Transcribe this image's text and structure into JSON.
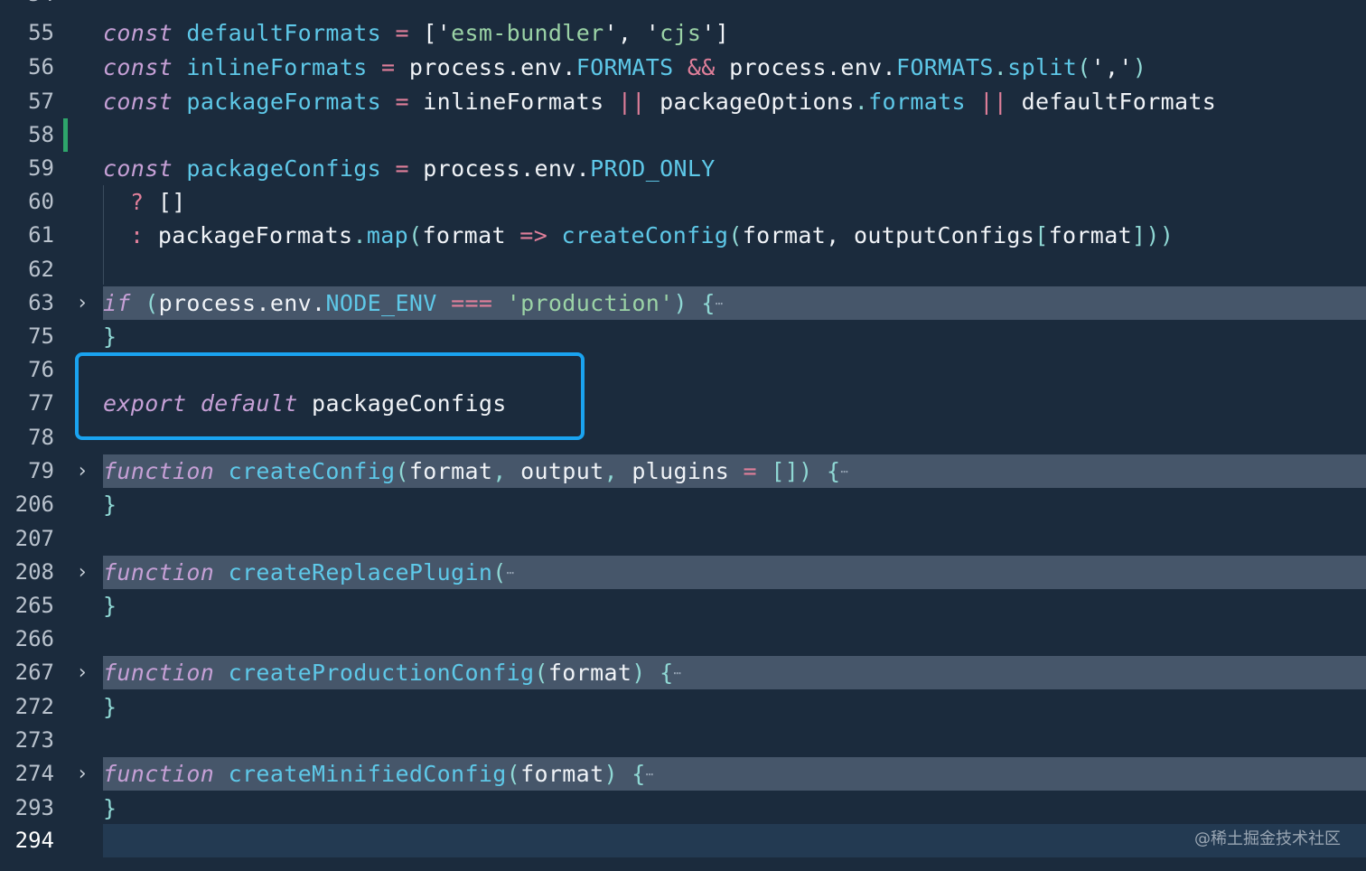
{
  "editor": {
    "top_partial_line_number": "54",
    "watermark": "@稀土掘金技术社区",
    "lines": {
      "l55": {
        "num": "55",
        "t": [
          "const",
          "defaultFormats",
          "=",
          "['",
          "esm-bundler",
          "', '",
          "cjs",
          "']"
        ]
      },
      "l56": {
        "num": "56",
        "t": [
          "const",
          "inlineFormats",
          "=",
          "process",
          ".env.",
          "FORMATS",
          "&&",
          "process",
          ".env.",
          "FORMATS",
          ".",
          "split",
          "(",
          "','",
          ")"
        ]
      },
      "l57": {
        "num": "57",
        "t": [
          "const",
          "packageFormats",
          "=",
          "inlineFormats",
          "||",
          "packageOptions",
          ".",
          "formats",
          "||",
          "defaultFormats"
        ]
      },
      "l58": {
        "num": "58"
      },
      "l59": {
        "num": "59",
        "t": [
          "const",
          "packageConfigs",
          "=",
          "process",
          ".env.",
          "PROD_ONLY"
        ]
      },
      "l60": {
        "num": "60",
        "t": [
          "?",
          "[]"
        ]
      },
      "l61": {
        "num": "61",
        "t": [
          ":",
          "packageFormats",
          ".",
          "map",
          "(",
          "format",
          "=>",
          "createConfig",
          "(",
          "format,",
          "outputConfigs",
          "[",
          "format",
          "]",
          "))"
        ]
      },
      "l62": {
        "num": "62"
      },
      "l63": {
        "num": "63",
        "t": [
          "if",
          "(",
          "process",
          ".env.",
          "NODE_ENV",
          "===",
          "'production'",
          ")",
          "{",
          "⋯"
        ]
      },
      "l75": {
        "num": "75",
        "t": [
          "}"
        ]
      },
      "l76": {
        "num": "76"
      },
      "l77": {
        "num": "77",
        "t": [
          "export",
          "default",
          "packageConfigs"
        ]
      },
      "l78": {
        "num": "78"
      },
      "l79": {
        "num": "79",
        "t": [
          "function",
          "createConfig",
          "(",
          "format",
          ",",
          "output",
          ",",
          "plugins",
          "=",
          "[])",
          "{",
          "⋯"
        ]
      },
      "l206": {
        "num": "206",
        "t": [
          "}"
        ]
      },
      "l207": {
        "num": "207"
      },
      "l208": {
        "num": "208",
        "t": [
          "function",
          "createReplacePlugin",
          "(",
          "⋯"
        ]
      },
      "l265": {
        "num": "265",
        "t": [
          "}"
        ]
      },
      "l266": {
        "num": "266"
      },
      "l267": {
        "num": "267",
        "t": [
          "function",
          "createProductionConfig",
          "(",
          "format",
          ")",
          "{",
          "⋯"
        ]
      },
      "l272": {
        "num": "272",
        "t": [
          "}"
        ]
      },
      "l273": {
        "num": "273"
      },
      "l274": {
        "num": "274",
        "t": [
          "function",
          "createMinifiedConfig",
          "(",
          "format",
          ")",
          "{",
          "⋯"
        ]
      },
      "l293": {
        "num": "293",
        "t": [
          "}"
        ]
      },
      "l294": {
        "num": "294"
      }
    },
    "fold_icon": "chevron-right-icon"
  }
}
